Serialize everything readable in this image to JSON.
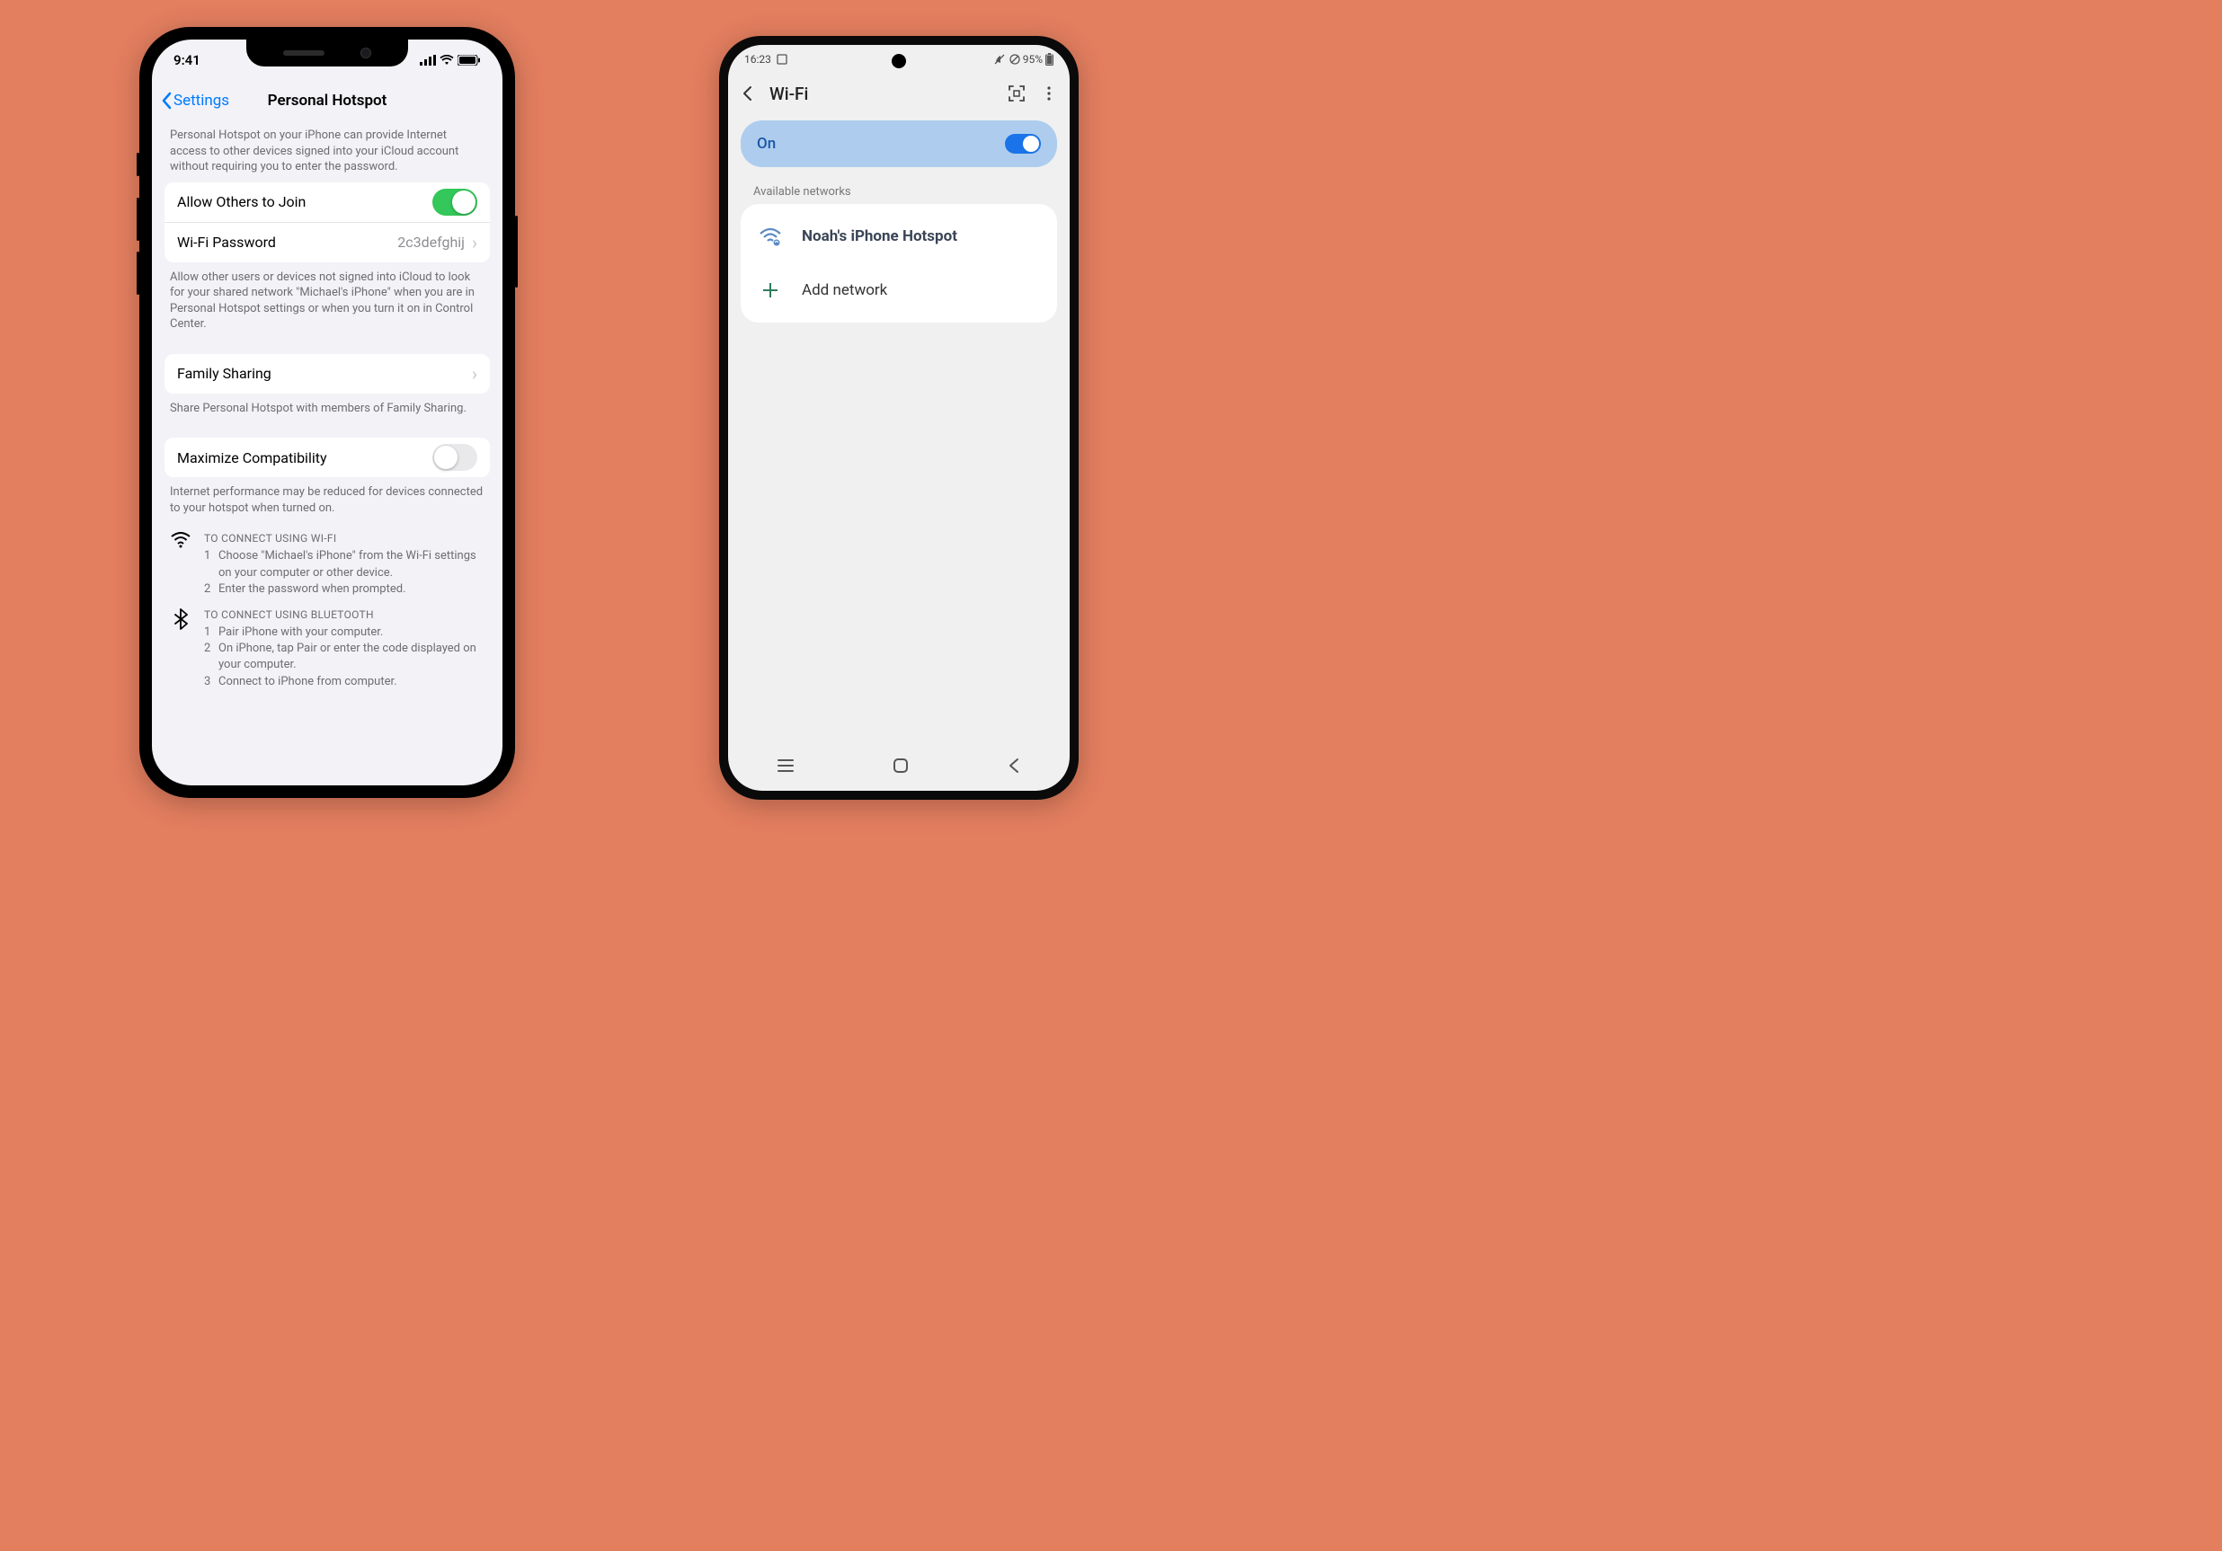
{
  "iphone": {
    "status": {
      "time": "9:41"
    },
    "nav": {
      "back": "Settings",
      "title": "Personal Hotspot"
    },
    "intro": "Personal Hotspot on your iPhone can provide Internet access to other devices signed into your iCloud account without requiring you to enter the password.",
    "group1": {
      "allow_label": "Allow Others to Join",
      "pw_label": "Wi-Fi Password",
      "pw_value": "2c3defghij"
    },
    "note1": "Allow other users or devices not signed into iCloud to look for your shared network \"Michael's iPhone\" when you are in Personal Hotspot settings or when you turn it on in Control Center.",
    "group2": {
      "family_label": "Family Sharing"
    },
    "note2": "Share Personal Hotspot with members of Family Sharing.",
    "group3": {
      "compat_label": "Maximize Compatibility"
    },
    "note3": "Internet performance may be reduced for devices connected to your hotspot when turned on.",
    "wifi_head": "TO CONNECT USING WI-FI",
    "wifi_steps": [
      "Choose \"Michael's iPhone\" from the Wi-Fi settings on your computer or other device.",
      "Enter the password when prompted."
    ],
    "bt_head": "TO CONNECT USING BLUETOOTH",
    "bt_steps": [
      "Pair iPhone with your computer.",
      "On iPhone, tap Pair or enter the code displayed on your computer.",
      "Connect to iPhone from computer."
    ]
  },
  "android": {
    "status": {
      "time": "16:23",
      "battery": "95%"
    },
    "title": "Wi-Fi",
    "on_label": "On",
    "available_label": "Available networks",
    "network_name": "Noah's iPhone Hotspot",
    "add_network": "Add network"
  }
}
